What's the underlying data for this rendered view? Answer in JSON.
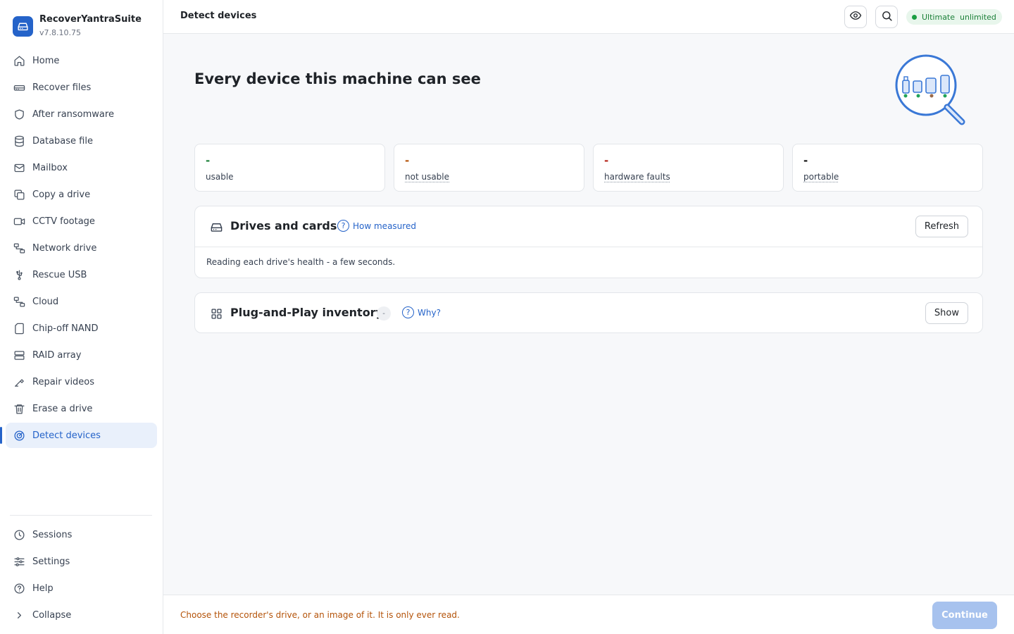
{
  "app": {
    "name": "RecoverYantraSuite",
    "version": "v7.8.10.75"
  },
  "sidebar": {
    "items": [
      {
        "label": "Home"
      },
      {
        "label": "Recover files"
      },
      {
        "label": "After ransomware"
      },
      {
        "label": "Database file"
      },
      {
        "label": "Mailbox"
      },
      {
        "label": "Copy a drive"
      },
      {
        "label": "CCTV footage"
      },
      {
        "label": "Network drive"
      },
      {
        "label": "Rescue USB"
      },
      {
        "label": "Cloud"
      },
      {
        "label": "Chip-off NAND"
      },
      {
        "label": "RAID array"
      },
      {
        "label": "Repair videos"
      },
      {
        "label": "Erase a drive"
      },
      {
        "label": "Detect devices",
        "active": true
      }
    ],
    "bottom": [
      {
        "label": "Sessions"
      },
      {
        "label": "Settings"
      },
      {
        "label": "Help"
      },
      {
        "label": "Collapse"
      }
    ]
  },
  "topbar": {
    "title": "Detect devices",
    "plan": "Ultimate  unlimited"
  },
  "page": {
    "title": "Every device this machine can see"
  },
  "stats": [
    {
      "value": "-",
      "label": "usable",
      "color": "#1a7f37"
    },
    {
      "value": "-",
      "label": "not usable",
      "color": "#b45309"
    },
    {
      "value": "-",
      "label": "hardware faults",
      "color": "#b42318"
    },
    {
      "value": "-",
      "label": "portable",
      "color": "#111111"
    }
  ],
  "drives": {
    "title": "Drives and cards",
    "help": "How measured",
    "button": "Refresh",
    "status": "Reading each drive's health - a few seconds."
  },
  "pnp": {
    "title": "Plug-and-Play inventory",
    "count": "-",
    "help": "Why?",
    "button": "Show"
  },
  "footer": {
    "message": "Choose the recorder's drive, or an image of it. It is only ever read.",
    "continue": "Continue"
  },
  "colors": {
    "accent": "#2563c9",
    "success": "#1a7f37",
    "warning": "#b45309",
    "danger": "#b42318"
  }
}
